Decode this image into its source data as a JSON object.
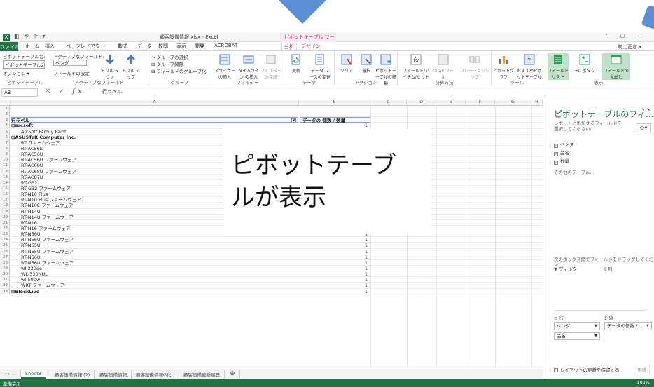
{
  "window": {
    "quick_access": "◧ ⟲ ⟳ ▾",
    "title": "顧客設備情報.xlsx - Excel",
    "pivot_tools": "ピボットテーブル ツール",
    "controls": "? ▢ –",
    "user": "村上正彦 ▾"
  },
  "tabs": [
    "ホーム",
    "挿入",
    "ページレイアウト",
    "数式",
    "データ",
    "校閲",
    "表示",
    "開発",
    "ACROBAT"
  ],
  "file_tab": "ファイル",
  "ctx_tabs": {
    "analyze": "分析",
    "design": "デザイン"
  },
  "ribbon": {
    "pivot_name_label": "ピボットテーブル名:",
    "pivot_name_value": "ピボットテーブル2",
    "active_field_label": "アクティブなフィールド:",
    "active_field_value": "ベンダ",
    "options_label": "オプション ▾",
    "field_settings": "フィールドの設定",
    "drilldown": "ドリル ダウン",
    "drillup": "ドリル アップ",
    "groups": {
      "pivot": "ピボットテーブル",
      "active": "アクティブなフィールド",
      "group": "グループ",
      "filter": "フィルター",
      "data": "データ",
      "actions": "アクション",
      "calc": "計算方法",
      "tools": "ツール",
      "show": "表示"
    },
    "group_items": [
      "→ グループの選択",
      "⊞ グループ解除",
      "⊟ フィールドのグループ化"
    ],
    "buttons": {
      "slicer": "スライサー の挿入",
      "timeline": "タイムライン の挿入",
      "filter_conn": "フィルターの接続",
      "refresh": "更新",
      "change_source": "データ ソースの変更",
      "clear": "クリア",
      "select": "選択",
      "move": "ピボットテーブルの移動",
      "fields_items": "フィールド/アイテム/セット",
      "olap": "OLAP ツール",
      "relations": "リレーションシップ",
      "pivotchart": "ピボットグラフ",
      "recommended": "おすすめピボットテーブル",
      "field_list": "フィールドリスト",
      "plus_minus": "+/- ボタン",
      "field_headers": "フィールドの見出し"
    }
  },
  "formula_bar": {
    "name_box": "A3",
    "value": "行ラベル"
  },
  "columns": [
    "A",
    "B",
    "C",
    "D",
    "E",
    "F",
    "G",
    "H"
  ],
  "rows": [
    {
      "n": "1",
      "a": "",
      "b": "",
      "style": ""
    },
    {
      "n": "2",
      "a": "",
      "b": "",
      "style": ""
    },
    {
      "n": "3",
      "a": "行ラベル",
      "b": "データの 個数 / 数量",
      "style": "hdr"
    },
    {
      "n": "4",
      "a": "⊟arcsoft",
      "b": "1",
      "style": "l0"
    },
    {
      "n": "5",
      "a": "ArcSoft Family Paint",
      "b": "1",
      "style": "l1"
    },
    {
      "n": "6",
      "a": "⊟ASUSTeK Computer Inc.",
      "b": "",
      "style": "l0"
    },
    {
      "n": "7",
      "a": "RT ファームウェア",
      "b": "",
      "style": "l1"
    },
    {
      "n": "8",
      "a": "RT-AC56S",
      "b": "",
      "style": "l1"
    },
    {
      "n": "9",
      "a": "RT-AC56U",
      "b": "",
      "style": "l1"
    },
    {
      "n": "10",
      "a": "RT-AC56U ファームウェア",
      "b": "",
      "style": "l1"
    },
    {
      "n": "11",
      "a": "RT-AC68U",
      "b": "",
      "style": "l1"
    },
    {
      "n": "12",
      "a": "RT-AC68U ファームウェア",
      "b": "",
      "style": "l1"
    },
    {
      "n": "13",
      "a": "RT-AC87U",
      "b": "",
      "style": "l1"
    },
    {
      "n": "14",
      "a": "RT-G32",
      "b": "",
      "style": "l1"
    },
    {
      "n": "15",
      "a": "RT-G32 ファームウェア",
      "b": "",
      "style": "l1"
    },
    {
      "n": "16",
      "a": "RT-N10 Plus",
      "b": "",
      "style": "l1"
    },
    {
      "n": "17",
      "a": "RT-N10 Plus ファームウェア",
      "b": "1",
      "style": "l1"
    },
    {
      "n": "18",
      "a": "RT-N10E ファームウェア",
      "b": "1",
      "style": "l1"
    },
    {
      "n": "19",
      "a": "RT-N14U",
      "b": "1",
      "style": "l1"
    },
    {
      "n": "20",
      "a": "RT-N14U ファームウェア",
      "b": "1",
      "style": "l1"
    },
    {
      "n": "21",
      "a": "RT-N16",
      "b": "1",
      "style": "l1"
    },
    {
      "n": "22",
      "a": "RT-N16 ファームウェア",
      "b": "1",
      "style": "l1"
    },
    {
      "n": "23",
      "a": "RT-N56U",
      "b": "1",
      "style": "l1"
    },
    {
      "n": "24",
      "a": "RT-N56U ファームウェア",
      "b": "1",
      "style": "l1"
    },
    {
      "n": "25",
      "a": "RT-N65U",
      "b": "1",
      "style": "l1"
    },
    {
      "n": "26",
      "a": "RT-N65U ファームウェア",
      "b": "1",
      "style": "l1"
    },
    {
      "n": "27",
      "a": "RT-N66U",
      "b": "1",
      "style": "l1"
    },
    {
      "n": "28",
      "a": "RT-N66U ファームウェア",
      "b": "1",
      "style": "l1"
    },
    {
      "n": "29",
      "a": "wl-330ge",
      "b": "1",
      "style": "l1"
    },
    {
      "n": "30",
      "a": "WL-330NUL",
      "b": "1",
      "style": "l1"
    },
    {
      "n": "31",
      "a": "wl-500w",
      "b": "1",
      "style": "l1"
    },
    {
      "n": "32",
      "a": "WRT ファームウェア",
      "b": "1",
      "style": "l1"
    },
    {
      "n": "33",
      "a": "⊟BlockLive",
      "b": "1",
      "style": "l0"
    }
  ],
  "sheet_tabs": [
    "Sheet3",
    "顧客設備情報 (2)",
    "顧客設備情報",
    "顧客設備情報G化",
    "顧客設備更新履歴"
  ],
  "status": {
    "left": "準備完了",
    "zoom": "100%"
  },
  "pane": {
    "title": "ピボットテーブルのフィ...",
    "close": "▾ ×",
    "desc": "レポートに追加するフィールドを選択してください:",
    "fields": [
      "ベンダ",
      "品名",
      "数量"
    ],
    "more": "その他のテーブル...",
    "drag_hint": "次のボックス間でフィールドをドラッグしてください:",
    "areas": {
      "filter": "▼ フィルター",
      "cols": "⦀ 列",
      "rows": "≡ 行",
      "values": "Σ 値"
    },
    "row_chips": [
      "ベンダ",
      "品名"
    ],
    "value_chip": "データの個数 /...",
    "defer": "レイアウトの更新を保留する",
    "update": "更新"
  },
  "callout": {
    "line1": "ピボットテーブ",
    "line2": "ルが表示"
  },
  "colors": {
    "excel_green": "#217346",
    "pivot_accent": "#a23a75",
    "arrow_blue": "#5b8fd6"
  }
}
